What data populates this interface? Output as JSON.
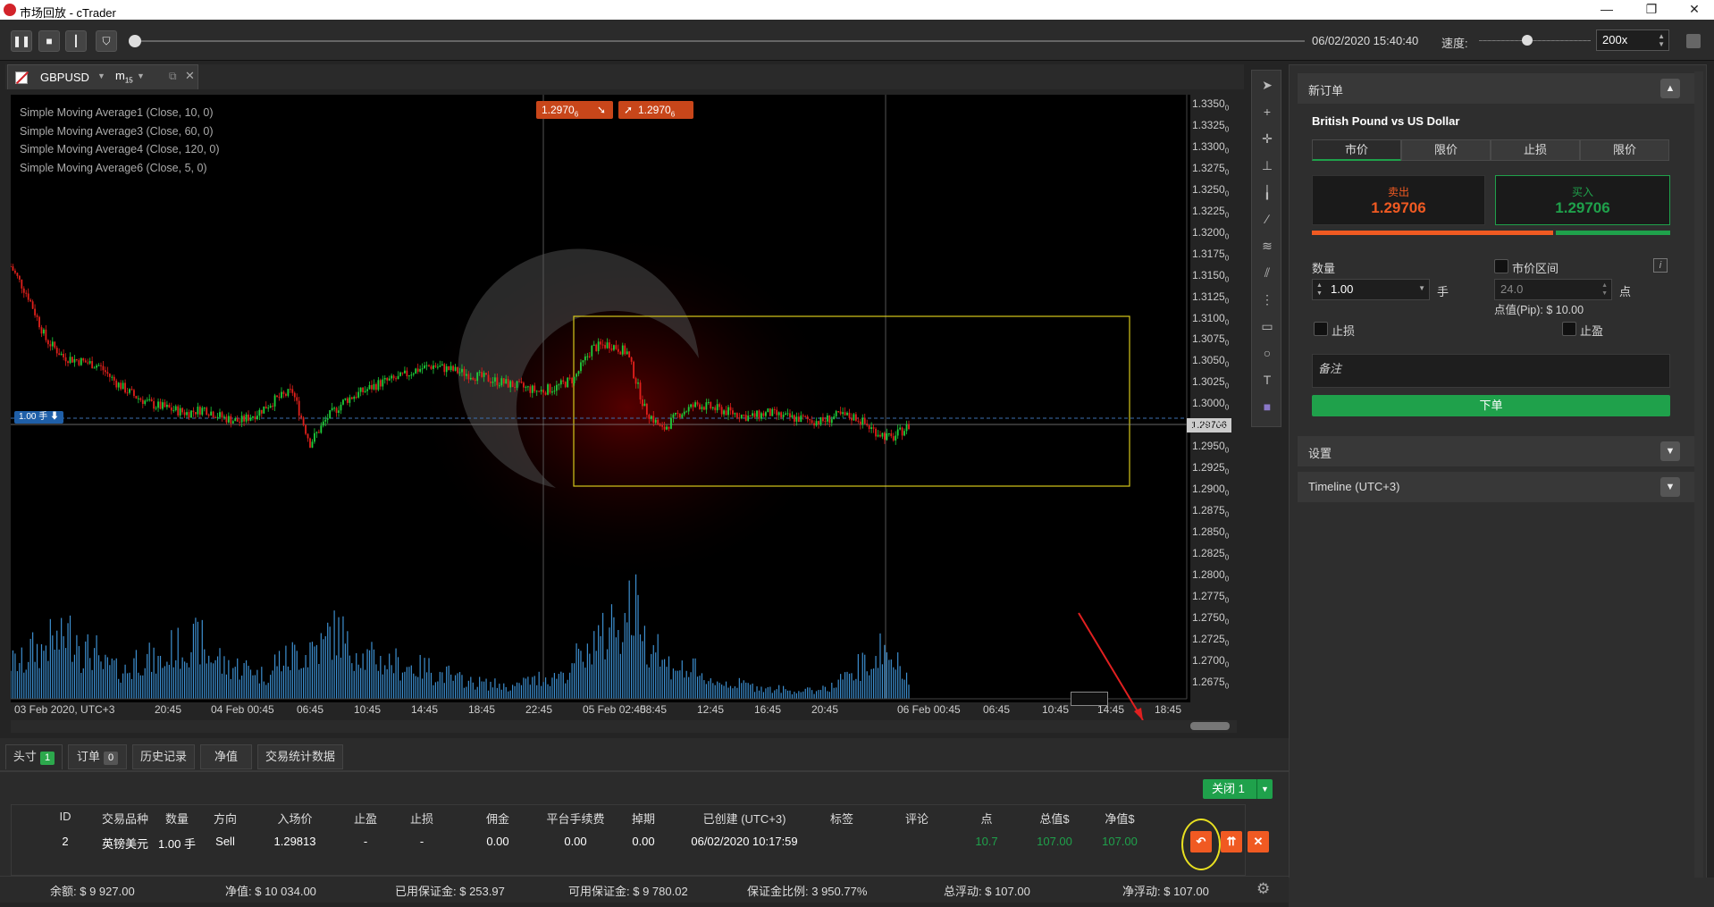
{
  "window": {
    "title": "市场回放 - cTrader",
    "min": "—",
    "max": "❐",
    "close": "✕"
  },
  "toolbar": {
    "datetime": "06/02/2020 15:40:40",
    "speed_label": "速度:",
    "speed_value": "200x",
    "replay_progress": 0.0
  },
  "chart": {
    "symbol": "GBPUSD",
    "timeframe": "m",
    "timeframe_sub": "15",
    "indicators": [
      "Simple Moving Average1 (Close, 10, 0)",
      "Simple Moving Average3 (Close, 60, 0)",
      "Simple Moving Average4 (Close, 120, 0)",
      "Simple Moving Average6 (Close, 5, 0)"
    ],
    "sell_quote": "1.2970",
    "sell_quote_sub": "6",
    "buy_quote": "1.2970",
    "buy_quote_sub": "6",
    "position_marker": "1.00 手",
    "current_price_label": "1.29706",
    "y_ticks": [
      "1.3350",
      "1.3325",
      "1.3300",
      "1.3275",
      "1.3250",
      "1.3225",
      "1.3200",
      "1.3175",
      "1.3150",
      "1.3125",
      "1.3100",
      "1.3075",
      "1.3050",
      "1.3025",
      "1.3000",
      "1.2975",
      "1.2950",
      "1.2925",
      "1.2900",
      "1.2875",
      "1.2850",
      "1.2825",
      "1.2800",
      "1.2775",
      "1.2750",
      "1.2725",
      "1.2700",
      "1.2675"
    ],
    "y_tick_sub": "0",
    "x_ticks": [
      "03 Feb 2020, UTC+3",
      "20:45",
      "04 Feb 00:45",
      "06:45",
      "10:45",
      "14:45",
      "18:45",
      "22:45",
      "05 Feb 02:45",
      "08:45",
      "12:45",
      "16:45",
      "20:45",
      "06 Feb 00:45",
      "06:45",
      "10:45",
      "14:45",
      "18:45"
    ]
  },
  "chart_data": {
    "type": "line",
    "title": "",
    "series": [
      {
        "name": "",
        "values": [
          1.3155,
          1.312,
          1.307,
          1.305,
          1.3045,
          1.304,
          1.302,
          1.3005,
          1.2995,
          1.299,
          1.2985,
          1.299,
          1.298,
          1.2975,
          1.2985,
          1.3,
          1.301,
          1.295,
          1.298,
          1.3,
          1.301,
          1.302,
          1.3025,
          1.3035,
          1.304,
          1.3035,
          1.303,
          1.3025,
          1.302,
          1.3015,
          1.301,
          1.3015,
          1.3025,
          1.306,
          1.3065,
          1.3055,
          1.299,
          1.2965,
          1.2985,
          1.2995,
          1.299,
          1.2985,
          1.298,
          1.2985,
          1.298,
          1.2978,
          1.2975,
          1.2982,
          1.298,
          1.2965,
          1.2955,
          1.297
        ]
      }
    ],
    "ylim": [
      1.266,
      1.336
    ],
    "volume": [
      45,
      60,
      70,
      80,
      58,
      40,
      35,
      50,
      45,
      62,
      70,
      52,
      40,
      38,
      30,
      48,
      55,
      65,
      80,
      62,
      50,
      45,
      40,
      38,
      30,
      24,
      20,
      18,
      15,
      22,
      26,
      32,
      50,
      75,
      95,
      110,
      70,
      42,
      35,
      25,
      20,
      18,
      15,
      12,
      10,
      10,
      15,
      25,
      40,
      60,
      42,
      30
    ]
  },
  "drawtools": [
    "cursor-icon",
    "crosshair-icon",
    "cross-icon",
    "trendline-icon",
    "vertical-line-icon",
    "ray-icon",
    "fibonacci-icon",
    "pitchfork-icon",
    "grid-icon",
    "rectangle-icon",
    "circle-icon",
    "text-icon",
    "color-icon"
  ],
  "neworder": {
    "header": "新订单",
    "instrument": "British Pound vs US Dollar",
    "tabs": [
      "市价",
      "限价",
      "止损",
      "限价"
    ],
    "sell_label": "卖出",
    "sell_price": "1.29706",
    "buy_label": "买入",
    "buy_price": "1.29706",
    "qty_label": "数量",
    "qty_value": "1.00",
    "qty_unit": "手",
    "range_label": "市价区间",
    "range_value": "24.0",
    "range_unit": "点",
    "pip_value": "点值(Pip): $ 10.00",
    "sl_label": "止损",
    "tp_label": "止盈",
    "note_label": "备注",
    "submit": "下单",
    "info": "i"
  },
  "sections": {
    "settings": "设置",
    "timeline": "Timeline (UTC+3)"
  },
  "bottom": {
    "tabs": [
      {
        "label": "头寸",
        "count": "1"
      },
      {
        "label": "订单",
        "count": "0"
      },
      {
        "label": "历史记录"
      },
      {
        "label": "净值"
      },
      {
        "label": "交易统计数据"
      }
    ],
    "close_btn": "关闭",
    "close_count": "1",
    "columns": [
      "ID",
      "交易品种",
      "数量",
      "方向",
      "入场价",
      "止盈",
      "止损",
      "佣金",
      "平台手续费",
      "掉期",
      "已创建 (UTC+3)",
      "标签",
      "评论",
      "点",
      "总值$",
      "净值$"
    ],
    "row": [
      "2",
      "英镑美元",
      "1.00 手",
      "Sell",
      "1.29813",
      "-",
      "-",
      "0.00",
      "0.00",
      "0.00",
      "06/02/2020 10:17:59",
      "",
      "",
      "10.7",
      "107.00",
      "107.00"
    ],
    "status": {
      "balance": "余额: $ 9 927.00",
      "equity": "净值: $ 10 034.00",
      "used_margin": "已用保证金: $ 253.97",
      "free_margin": "可用保证金: $ 9 780.02",
      "margin_level": "保证金比例: 3 950.77%",
      "float": "总浮动: $ 107.00",
      "net_float": "净浮动: $ 107.00"
    }
  },
  "colors": {
    "buy": "#1fa14b",
    "sell": "#f05a22",
    "bull": "#1ecf3a",
    "bear": "#e0201b",
    "volume": "#3d8fd0"
  }
}
